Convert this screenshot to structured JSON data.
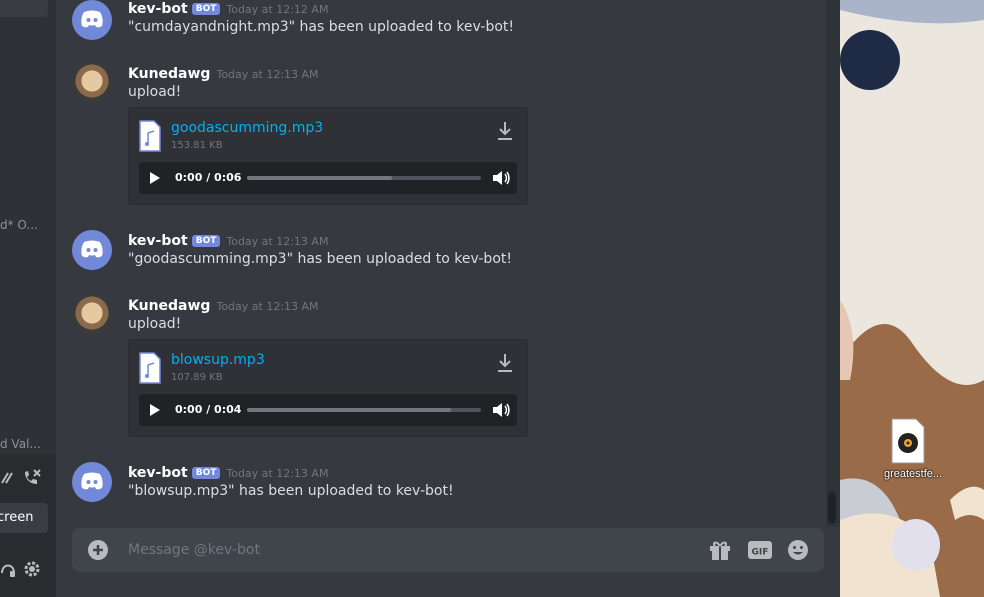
{
  "sidebar": {
    "cut_text_1": "d* O...",
    "cut_text_2": "d Val...",
    "screen_label": "creen"
  },
  "messages": [
    {
      "author": "kev-bot",
      "badge": "BOT",
      "timestamp": "Today at 12:12 AM",
      "text": "\"cumdayandnight.mp3\" has been uploaded to kev-bot!"
    },
    {
      "author": "Kunedawg",
      "timestamp": "Today at 12:13 AM",
      "text": "upload!",
      "attachment": {
        "filename": "goodascumming.mp3",
        "size": "153.81 KB",
        "time": "0:00 / 0:06",
        "progress": 0.62
      }
    },
    {
      "author": "kev-bot",
      "badge": "BOT",
      "timestamp": "Today at 12:13 AM",
      "text": "\"goodascumming.mp3\" has been uploaded to kev-bot!"
    },
    {
      "author": "Kunedawg",
      "timestamp": "Today at 12:13 AM",
      "text": "upload!",
      "attachment": {
        "filename": "blowsup.mp3",
        "size": "107.89 KB",
        "time": "0:00 / 0:04",
        "progress": 0.87
      }
    },
    {
      "author": "kev-bot",
      "badge": "BOT",
      "timestamp": "Today at 12:13 AM",
      "text": "\"blowsup.mp3\" has been uploaded to kev-bot!"
    }
  ],
  "composer": {
    "placeholder": "Message @kev-bot"
  },
  "desktop": {
    "file_label": "greatestfe..."
  },
  "colors": {
    "accent": "#7289da",
    "link": "#00b0f4",
    "bg": "#36393f"
  }
}
